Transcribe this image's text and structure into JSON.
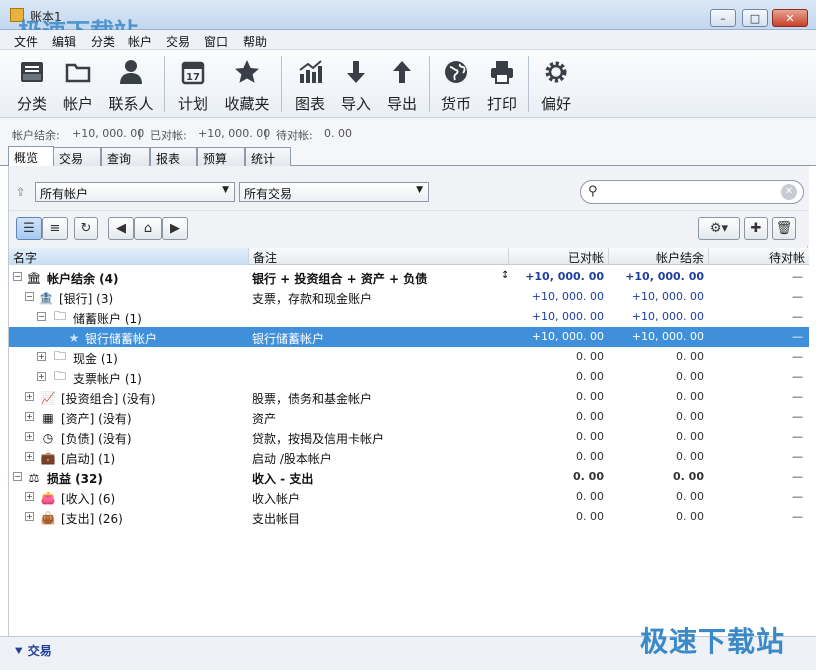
{
  "window": {
    "title": "账本1"
  },
  "menu": [
    "文件",
    "编辑",
    "分类",
    "帐户",
    "交易",
    "窗口",
    "帮助"
  ],
  "toolbar": {
    "categories": "分类",
    "accounts": "帐户",
    "contacts": "联系人",
    "schedule": "计划",
    "favorites": "收藏夹",
    "charts": "图表",
    "import": "导入",
    "export": "导出",
    "currency": "货币",
    "print": "打印",
    "preferences": "偏好"
  },
  "status": {
    "balance_label": "帐户结余:",
    "balance_value": "+10, 000. 00",
    "cleared_label": "已对帐:",
    "cleared_value": "+10, 000. 00",
    "pending_label": "待对帐:",
    "pending_value": "0. 00"
  },
  "tabs": [
    "概览",
    "交易",
    "查询",
    "报表",
    "预算",
    "统计"
  ],
  "filters": {
    "account": "所有帐户",
    "transaction": "所有交易"
  },
  "table": {
    "headers": {
      "name": "名字",
      "note": "备注",
      "cleared": "已对帐",
      "balance": "帐户结余",
      "pending": "待对帐"
    },
    "rows": [
      {
        "name": "帐户结余 (4)",
        "note": "银行 + 投资组合 + 资产 + 负债",
        "cleared": "+10, 000. 00",
        "balance": "+10, 000. 00",
        "pending": "—"
      },
      {
        "name": "[银行] (3)",
        "note": "支票，存款和现金账户",
        "cleared": "+10, 000. 00",
        "balance": "+10, 000. 00",
        "pending": "—"
      },
      {
        "name": "储蓄账户 (1)",
        "note": "",
        "cleared": "+10, 000. 00",
        "balance": "+10, 000. 00",
        "pending": "—"
      },
      {
        "name": "银行储蓄帐户",
        "note": "银行储蓄帐户",
        "cleared": "+10, 000. 00",
        "balance": "+10, 000. 00",
        "pending": "—"
      },
      {
        "name": "现金 (1)",
        "note": "",
        "cleared": "0. 00",
        "balance": "0. 00",
        "pending": "—"
      },
      {
        "name": "支票帐户 (1)",
        "note": "",
        "cleared": "0. 00",
        "balance": "0. 00",
        "pending": "—"
      },
      {
        "name": "[投资组合] (没有)",
        "note": "股票，债务和基金帐户",
        "cleared": "0. 00",
        "balance": "0. 00",
        "pending": "—"
      },
      {
        "name": "[资产] (没有)",
        "note": "资产",
        "cleared": "0. 00",
        "balance": "0. 00",
        "pending": "—"
      },
      {
        "name": "[负债] (没有)",
        "note": "贷款，按揭及信用卡帐户",
        "cleared": "0. 00",
        "balance": "0. 00",
        "pending": "—"
      },
      {
        "name": "[启动] (1)",
        "note": "启动 /股本帐户",
        "cleared": "0. 00",
        "balance": "0. 00",
        "pending": "—"
      },
      {
        "name": "损益 (32)",
        "note": "收入 - 支出",
        "cleared": "0. 00",
        "balance": "0. 00",
        "pending": "—"
      },
      {
        "name": "[收入] (6)",
        "note": "收入帐户",
        "cleared": "0. 00",
        "balance": "0. 00",
        "pending": "—"
      },
      {
        "name": "[支出] (26)",
        "note": "支出帐目",
        "cleared": "0. 00",
        "balance": "0. 00",
        "pending": "—"
      }
    ]
  },
  "bottom": {
    "label": "交易"
  },
  "watermark": {
    "top": "极速下载站",
    "bottom": "极速下载站"
  }
}
